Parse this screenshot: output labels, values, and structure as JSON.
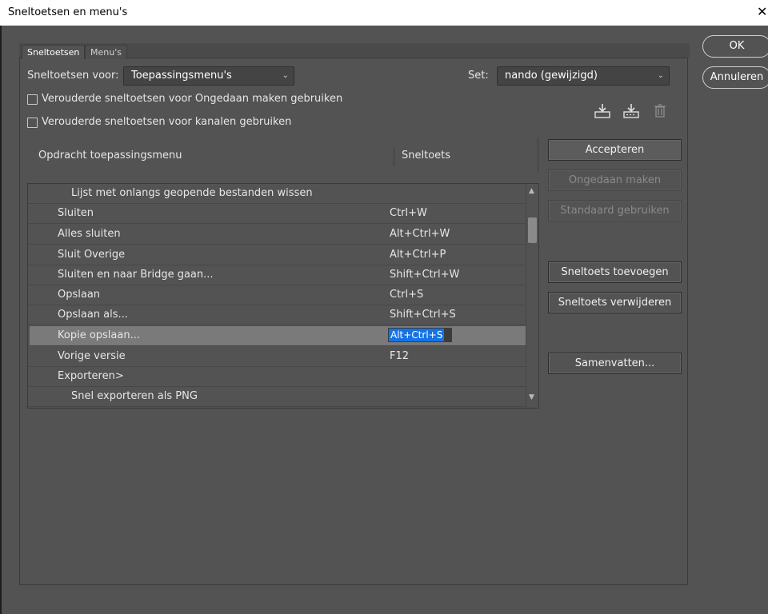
{
  "window": {
    "title": "Sneltoetsen en menu's",
    "close_glyph": "✕"
  },
  "tabs": [
    {
      "label": "Sneltoetsen"
    },
    {
      "label": "Menu's"
    }
  ],
  "shortcuts_for": {
    "label": "Sneltoetsen voor:",
    "value": "Toepassingsmenu's"
  },
  "set": {
    "label": "Set:",
    "value": "nando (gewijzigd)"
  },
  "options": [
    {
      "label": "Verouderde sneltoetsen voor Ongedaan maken gebruiken",
      "checked": false
    },
    {
      "label": "Verouderde sneltoetsen voor kanalen gebruiken",
      "checked": false
    }
  ],
  "icons": {
    "save_set": "save-set-icon",
    "new_set": "new-set-icon",
    "delete_set": "trash-icon"
  },
  "table": {
    "col_command": "Opdracht toepassingsmenu",
    "col_shortcut": "Sneltoets",
    "rows": [
      {
        "command": "Lijst met onlangs geopende bestanden wissen",
        "shortcut": "",
        "indent": 2
      },
      {
        "command": "Sluiten",
        "shortcut": "Ctrl+W",
        "indent": 1
      },
      {
        "command": "Alles sluiten",
        "shortcut": "Alt+Ctrl+W",
        "indent": 1
      },
      {
        "command": "Sluit Overige",
        "shortcut": "Alt+Ctrl+P",
        "indent": 1
      },
      {
        "command": "Sluiten en naar Bridge gaan...",
        "shortcut": "Shift+Ctrl+W",
        "indent": 1
      },
      {
        "command": "Opslaan",
        "shortcut": "Ctrl+S",
        "indent": 1
      },
      {
        "command": "Opslaan als...",
        "shortcut": "Shift+Ctrl+S",
        "indent": 1
      },
      {
        "command": "Kopie opslaan...",
        "shortcut": "Alt+Ctrl+S",
        "indent": 1,
        "selected": true
      },
      {
        "command": "Vorige versie",
        "shortcut": "F12",
        "indent": 1
      },
      {
        "command": "Exporteren>",
        "shortcut": "",
        "indent": 1
      },
      {
        "command": "Snel exporteren als PNG",
        "shortcut": "",
        "indent": 2
      }
    ]
  },
  "buttons": {
    "accept": "Accepteren",
    "undo": "Ongedaan maken",
    "use_default": "Standaard gebruiken",
    "add_shortcut": "Sneltoets toevoegen",
    "remove_shortcut": "Sneltoets verwijderen",
    "summarize": "Samenvatten...",
    "ok": "OK",
    "cancel": "Annuleren"
  }
}
